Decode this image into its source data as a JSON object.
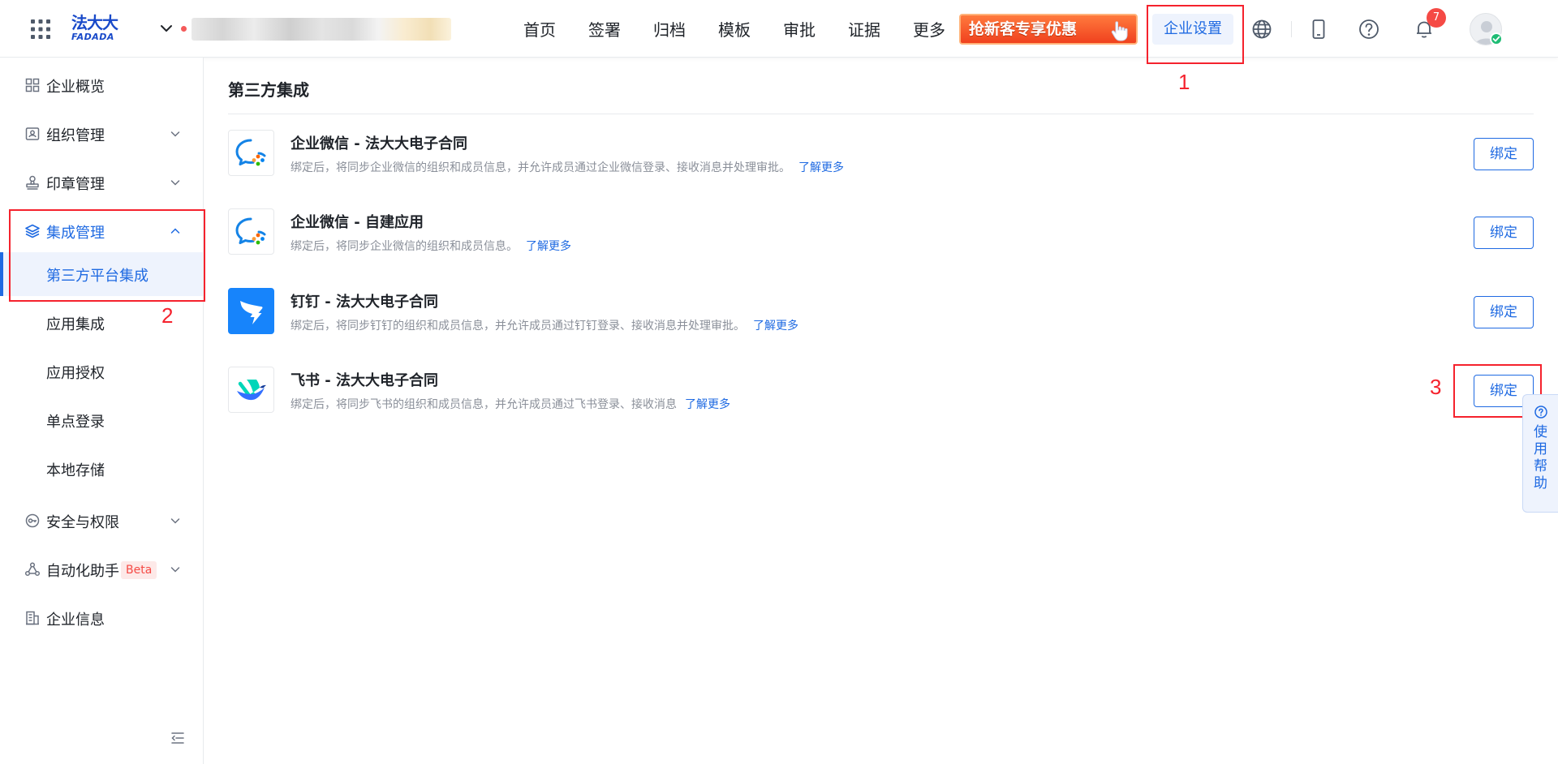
{
  "header": {
    "logo_cn": "法大大",
    "logo_en": "FADADA",
    "nav": [
      "首页",
      "签署",
      "归档",
      "模板",
      "审批",
      "证据",
      "更多"
    ],
    "promo_label": "抢新客专享优惠",
    "enterprise_settings": "企业设置",
    "notification_count": "7"
  },
  "sidebar": {
    "items": [
      {
        "label": "企业概览"
      },
      {
        "label": "组织管理"
      },
      {
        "label": "印章管理"
      },
      {
        "label": "集成管理"
      },
      {
        "label": "安全与权限"
      },
      {
        "label": "自动化助手"
      },
      {
        "label": "企业信息"
      }
    ],
    "sub_items": [
      "第三方平台集成",
      "应用集成",
      "应用授权",
      "单点登录",
      "本地存储"
    ],
    "beta": "Beta"
  },
  "main": {
    "title": "第三方集成",
    "bind_label": "绑定",
    "learn_more": "了解更多",
    "integrations": [
      {
        "name": "企业微信 - 法大大电子合同",
        "desc": "绑定后，将同步企业微信的组织和成员信息，并允许成员通过企业微信登录、接收消息并处理审批。"
      },
      {
        "name": "企业微信 - 自建应用",
        "desc": "绑定后，将同步企业微信的组织和成员信息。"
      },
      {
        "name": "钉钉 - 法大大电子合同",
        "desc": "绑定后，将同步钉钉的组织和成员信息，并允许成员通过钉钉登录、接收消息并处理审批。"
      },
      {
        "name": "飞书 - 法大大电子合同",
        "desc": "绑定后，将同步飞书的组织和成员信息，并允许成员通过飞书登录、接收消息"
      }
    ]
  },
  "annotations": [
    "1",
    "2",
    "3"
  ],
  "help_tab": "使用帮助",
  "colors": {
    "accent": "#1f6ae2",
    "annotation": "#f5222d",
    "promo": "#f0411e",
    "badge": "#f54a45",
    "logo": "#1849c9"
  }
}
